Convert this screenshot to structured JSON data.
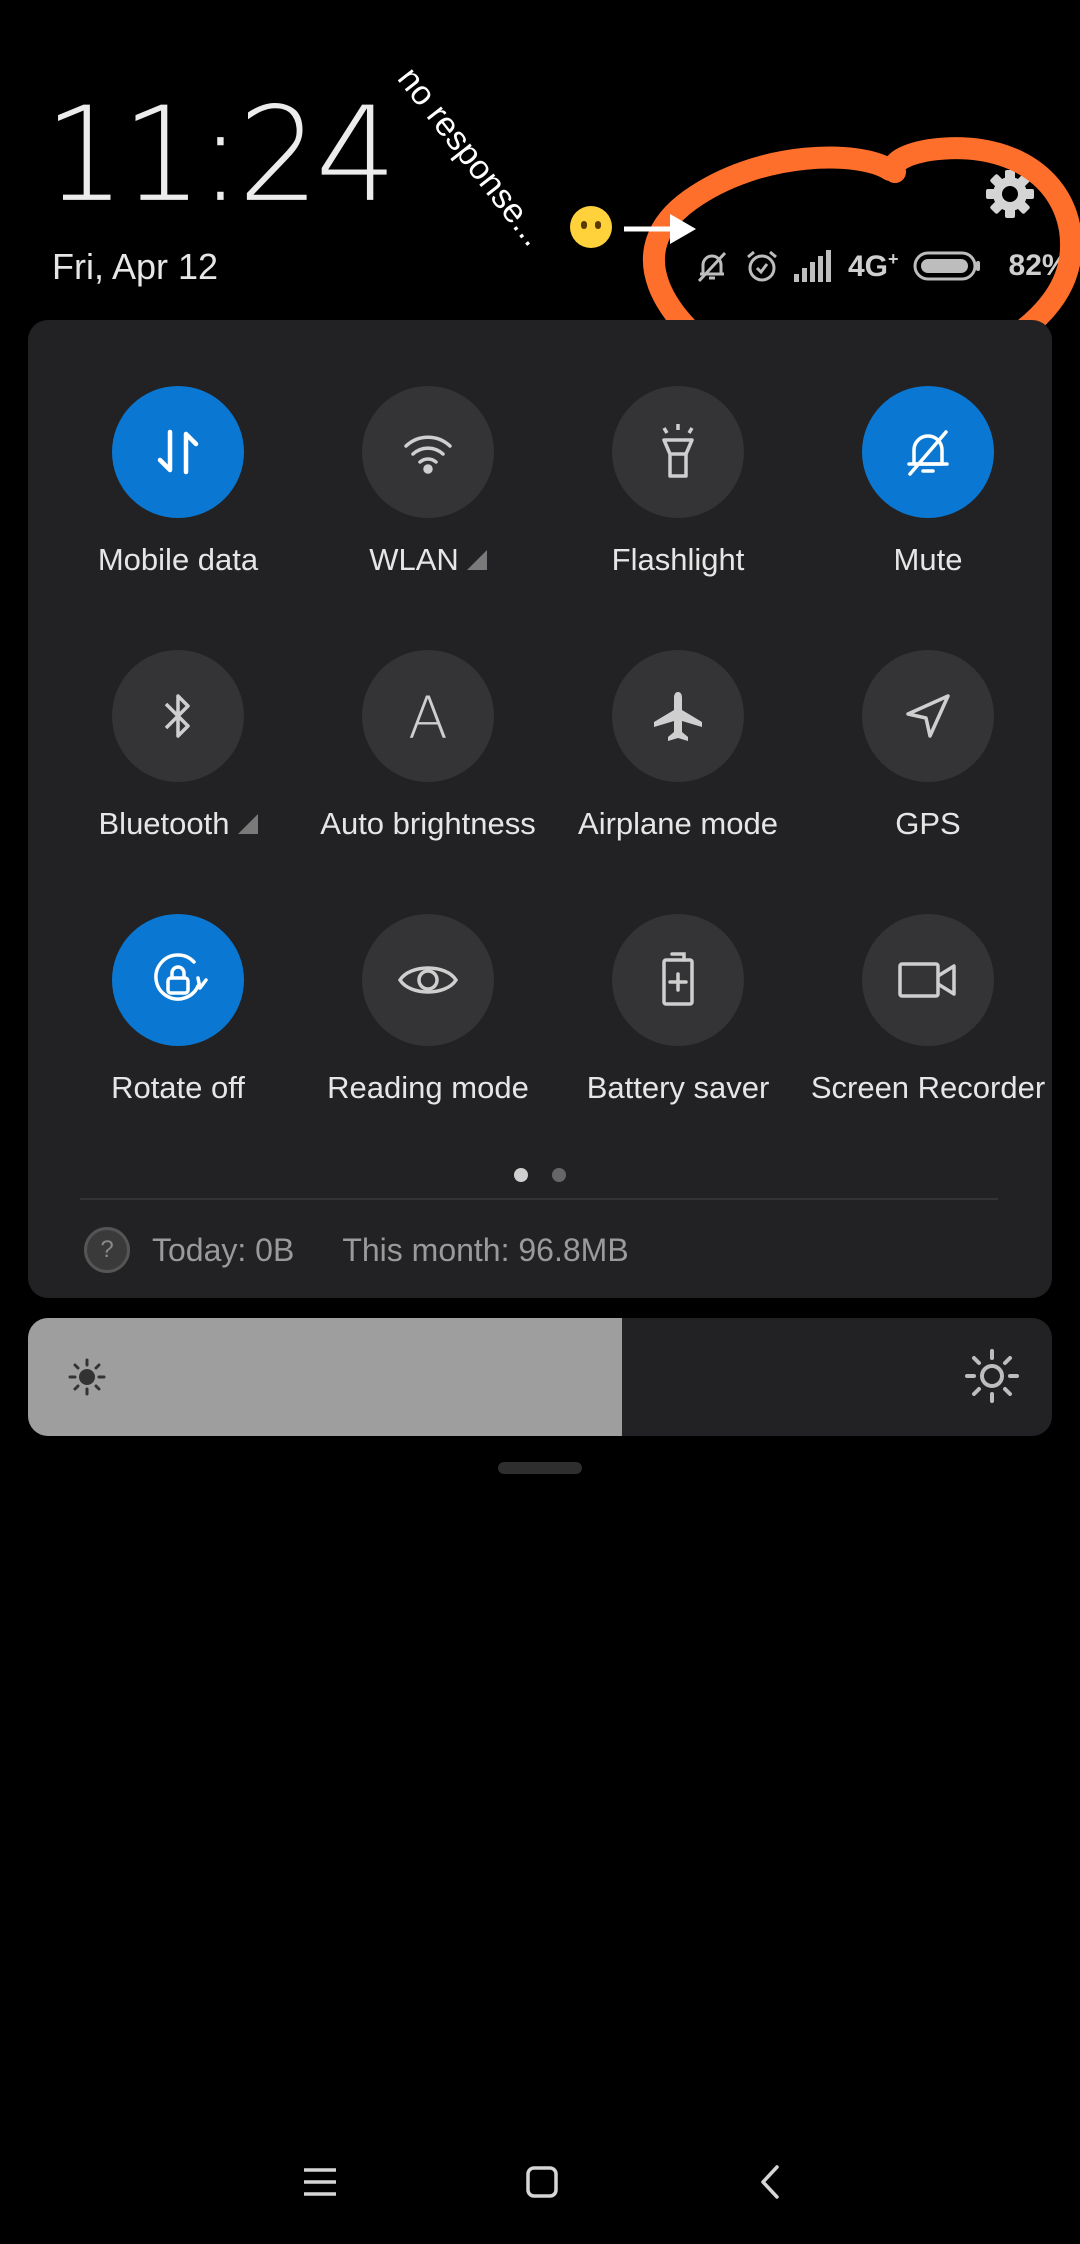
{
  "lockscreen": {
    "time": "11:24",
    "date": "Fri, Apr 12"
  },
  "status_bar": {
    "icons": [
      "mute-bell-icon",
      "alarm-icon",
      "signal-icon",
      "battery-icon"
    ],
    "network_type": "4G",
    "network_plus": "+",
    "battery_percent": "82%",
    "battery_level": 0.82
  },
  "annotation": {
    "text": "no response...",
    "emoji": "😶",
    "circle_color": "#ff6f2c"
  },
  "quick_settings": {
    "tiles": [
      {
        "label": "Mobile data",
        "icon": "mobile-data-icon",
        "active": true,
        "has_more": false
      },
      {
        "label": "WLAN",
        "icon": "wifi-icon",
        "active": false,
        "has_more": true
      },
      {
        "label": "Flashlight",
        "icon": "flashlight-icon",
        "active": false,
        "has_more": false
      },
      {
        "label": "Mute",
        "icon": "mute-bell-icon",
        "active": true,
        "has_more": false
      },
      {
        "label": "Bluetooth",
        "icon": "bluetooth-icon",
        "active": false,
        "has_more": true
      },
      {
        "label": "Auto brightness",
        "icon": "auto-brightness-icon",
        "active": false,
        "has_more": false
      },
      {
        "label": "Airplane mode",
        "icon": "airplane-icon",
        "active": false,
        "has_more": false
      },
      {
        "label": "GPS",
        "icon": "gps-icon",
        "active": false,
        "has_more": false
      },
      {
        "label": "Rotate off",
        "icon": "rotate-lock-icon",
        "active": true,
        "has_more": false
      },
      {
        "label": "Reading mode",
        "icon": "eye-icon",
        "active": false,
        "has_more": false
      },
      {
        "label": "Battery saver",
        "icon": "battery-saver-icon",
        "active": false,
        "has_more": false
      },
      {
        "label": "Screen Recorder",
        "icon": "video-camera-icon",
        "active": false,
        "has_more": false
      }
    ],
    "page_indicator": {
      "count": 2,
      "current": 1
    },
    "data_usage": {
      "today": "Today: 0B",
      "month": "This month: 96.8MB"
    }
  },
  "brightness": {
    "level": 0.58
  },
  "colors": {
    "accent": "#0a78d2",
    "panel_bg": "#222224",
    "tile_bg": "#343436",
    "annotation_orange": "#ff6f2c"
  },
  "nav_bar": {
    "buttons": [
      "menu-icon",
      "home-icon",
      "back-icon"
    ]
  }
}
